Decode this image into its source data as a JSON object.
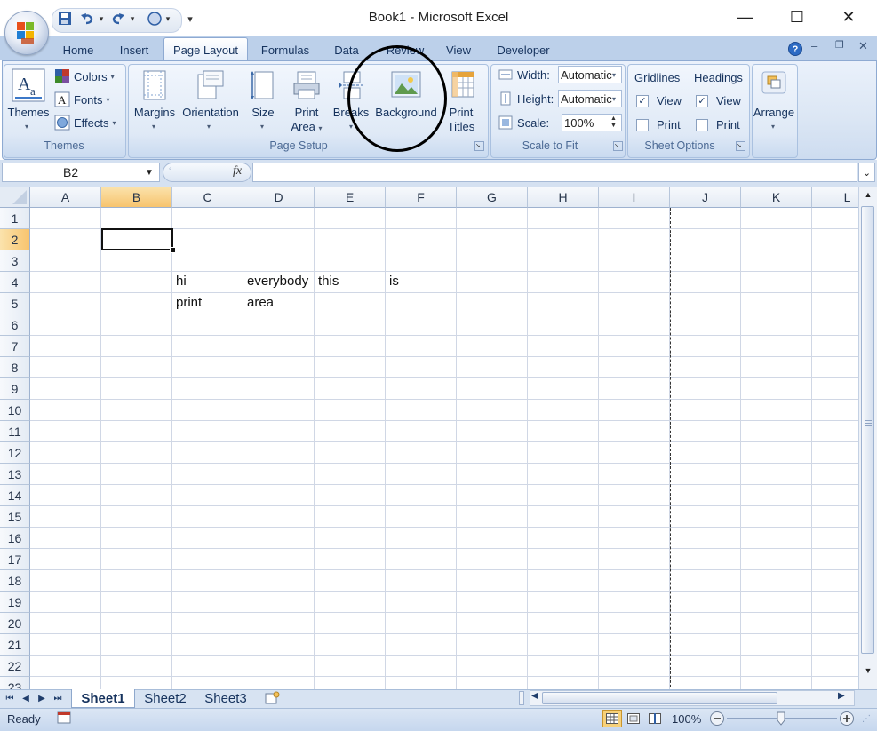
{
  "window": {
    "title": "Book1 - Microsoft Excel",
    "minimize": "—",
    "maximize": "☐",
    "close": "✕"
  },
  "quick_access": {
    "customize": "▾"
  },
  "tabs": [
    "Home",
    "Insert",
    "Page Layout",
    "Formulas",
    "Data",
    "Review",
    "View",
    "Developer"
  ],
  "active_tab": "Page Layout",
  "ribbon": {
    "themes_group": {
      "label": "Themes",
      "themes_button": "Themes",
      "colors": "Colors",
      "fonts": "Fonts",
      "effects": "Effects"
    },
    "page_setup_group": {
      "label": "Page Setup",
      "margins": "Margins",
      "orientation": "Orientation",
      "size": "Size",
      "print_area_line1": "Print",
      "print_area_line2": "Area",
      "breaks": "Breaks",
      "background": "Background",
      "print_titles_line1": "Print",
      "print_titles_line2": "Titles"
    },
    "scale_group": {
      "label": "Scale to Fit",
      "width_label": "Width:",
      "width_value": "Automatic",
      "height_label": "Height:",
      "height_value": "Automatic",
      "scale_label": "Scale:",
      "scale_value": "100%"
    },
    "sheet_options_group": {
      "label": "Sheet Options",
      "gridlines": "Gridlines",
      "headings": "Headings",
      "view": "View",
      "print": "Print"
    },
    "arrange_group": {
      "arrange": "Arrange"
    }
  },
  "formula_bar": {
    "name_box": "B2",
    "fx": "fx",
    "formula": ""
  },
  "grid": {
    "columns": [
      "A",
      "B",
      "C",
      "D",
      "E",
      "F",
      "G",
      "H",
      "I",
      "J",
      "K",
      "L"
    ],
    "selected_column": "B",
    "rows": [
      "1",
      "2",
      "3",
      "4",
      "5",
      "6",
      "7",
      "8",
      "9",
      "10",
      "11",
      "12",
      "13",
      "14",
      "15",
      "16",
      "17",
      "18",
      "19",
      "20",
      "21",
      "22",
      "23"
    ],
    "selected_row": "2",
    "cells": {
      "C4": "hi",
      "D4": "everybody",
      "E4": "this",
      "F4": "is",
      "C5": "print",
      "D5": "area"
    }
  },
  "sheets": [
    "Sheet1",
    "Sheet2",
    "Sheet3"
  ],
  "active_sheet": "Sheet1",
  "status": {
    "text": "Ready",
    "zoom": "100%"
  },
  "colors": {
    "ribbon_bg": "#dbe6f4",
    "tab_text": "#15325d",
    "selected_header": "#f7c46e"
  }
}
